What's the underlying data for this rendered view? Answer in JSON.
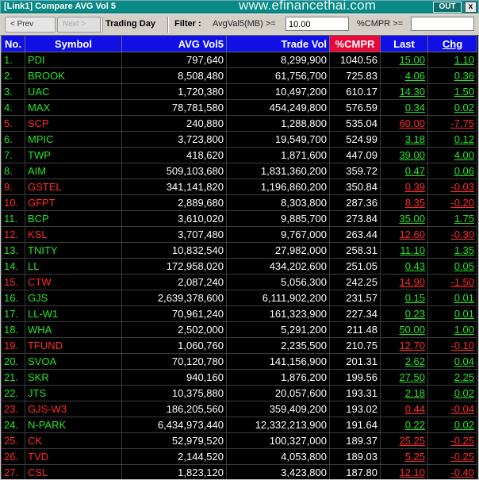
{
  "window": {
    "title": "[Link1] Compare AVG Vol 5",
    "watermark": "www.efinancethai.com",
    "out_label": "OUT",
    "close_label": "x"
  },
  "toolbar": {
    "prev_label": "< Prev",
    "next_label": "Next >",
    "trading_day_label": "Trading Day",
    "filter_label": "Filter :",
    "avgvol_caption": "AvgVal5(MB) >=",
    "avgvol_value": "10.00",
    "cmpr_caption": "%CMPR >=",
    "cmpr_value": ""
  },
  "colors": {
    "up": "#26e626",
    "down": "#ff2a2a",
    "header": "#1010e6",
    "sorted_header": "#e8083a"
  },
  "table": {
    "headers": {
      "no": "No.",
      "symbol": "Symbol",
      "avg_vol5": "AVG Vol5",
      "trade_vol": "Trade Vol",
      "cmpr": "%CMPR",
      "last": "Last",
      "chg": "Chg"
    },
    "rows": [
      {
        "no": "1.",
        "symbol": "PDI",
        "avg": "797,640",
        "vol": "8,299,900",
        "cmpr": "1040.56",
        "last": "15.00",
        "chg": "1.10",
        "dir": "up"
      },
      {
        "no": "2.",
        "symbol": "BROOK",
        "avg": "8,508,480",
        "vol": "61,756,700",
        "cmpr": "725.83",
        "last": "4.06",
        "chg": "0.36",
        "dir": "up"
      },
      {
        "no": "3.",
        "symbol": "UAC",
        "avg": "1,720,380",
        "vol": "10,497,200",
        "cmpr": "610.17",
        "last": "14.30",
        "chg": "1.50",
        "dir": "up"
      },
      {
        "no": "4.",
        "symbol": "MAX",
        "avg": "78,781,580",
        "vol": "454,249,800",
        "cmpr": "576.59",
        "last": "0.34",
        "chg": "0.02",
        "dir": "up"
      },
      {
        "no": "5.",
        "symbol": "SCP",
        "avg": "240,880",
        "vol": "1,288,800",
        "cmpr": "535.04",
        "last": "60.00",
        "chg": "-7.75",
        "dir": "down"
      },
      {
        "no": "6.",
        "symbol": "MPIC",
        "avg": "3,723,800",
        "vol": "19,549,700",
        "cmpr": "524.99",
        "last": "3.18",
        "chg": "0.12",
        "dir": "up"
      },
      {
        "no": "7.",
        "symbol": "TWP",
        "avg": "418,620",
        "vol": "1,871,600",
        "cmpr": "447.09",
        "last": "39.00",
        "chg": "4.00",
        "dir": "up"
      },
      {
        "no": "8.",
        "symbol": "AIM",
        "avg": "509,103,680",
        "vol": "1,831,360,200",
        "cmpr": "359.72",
        "last": "0.47",
        "chg": "0.06",
        "dir": "up"
      },
      {
        "no": "9.",
        "symbol": "GSTEL",
        "avg": "341,141,820",
        "vol": "1,196,860,200",
        "cmpr": "350.84",
        "last": "0.39",
        "chg": "-0.03",
        "dir": "down"
      },
      {
        "no": "10.",
        "symbol": "GFPT",
        "avg": "2,889,680",
        "vol": "8,303,800",
        "cmpr": "287.36",
        "last": "8.35",
        "chg": "-0.20",
        "dir": "down"
      },
      {
        "no": "11.",
        "symbol": "BCP",
        "avg": "3,610,020",
        "vol": "9,885,700",
        "cmpr": "273.84",
        "last": "35.00",
        "chg": "1.75",
        "dir": "up"
      },
      {
        "no": "12.",
        "symbol": "KSL",
        "avg": "3,707,480",
        "vol": "9,767,000",
        "cmpr": "263.44",
        "last": "12.60",
        "chg": "-0.30",
        "dir": "down"
      },
      {
        "no": "13.",
        "symbol": "TNITY",
        "avg": "10,832,540",
        "vol": "27,982,000",
        "cmpr": "258.31",
        "last": "11.10",
        "chg": "1.35",
        "dir": "up"
      },
      {
        "no": "14.",
        "symbol": "LL",
        "avg": "172,958,020",
        "vol": "434,202,600",
        "cmpr": "251.05",
        "last": "0.43",
        "chg": "0.05",
        "dir": "up"
      },
      {
        "no": "15.",
        "symbol": "CTW",
        "avg": "2,087,240",
        "vol": "5,056,300",
        "cmpr": "242.25",
        "last": "14.90",
        "chg": "-1.50",
        "dir": "down"
      },
      {
        "no": "16.",
        "symbol": "GJS",
        "avg": "2,639,378,600",
        "vol": "6,111,902,200",
        "cmpr": "231.57",
        "last": "0.15",
        "chg": "0.01",
        "dir": "up"
      },
      {
        "no": "17.",
        "symbol": "LL-W1",
        "avg": "70,961,240",
        "vol": "161,323,900",
        "cmpr": "227.34",
        "last": "0.23",
        "chg": "0.01",
        "dir": "up"
      },
      {
        "no": "18.",
        "symbol": "WHA",
        "avg": "2,502,000",
        "vol": "5,291,200",
        "cmpr": "211.48",
        "last": "50.00",
        "chg": "1.00",
        "dir": "up"
      },
      {
        "no": "19.",
        "symbol": "TFUND",
        "avg": "1,060,760",
        "vol": "2,235,500",
        "cmpr": "210.75",
        "last": "12.70",
        "chg": "-0.10",
        "dir": "down"
      },
      {
        "no": "20.",
        "symbol": "SVOA",
        "avg": "70,120,780",
        "vol": "141,156,900",
        "cmpr": "201.31",
        "last": "2.62",
        "chg": "0.04",
        "dir": "up"
      },
      {
        "no": "21.",
        "symbol": "SKR",
        "avg": "940,160",
        "vol": "1,876,200",
        "cmpr": "199.56",
        "last": "27.50",
        "chg": "2.25",
        "dir": "up"
      },
      {
        "no": "22.",
        "symbol": "JTS",
        "avg": "10,375,880",
        "vol": "20,057,600",
        "cmpr": "193.31",
        "last": "2.18",
        "chg": "0.02",
        "dir": "up"
      },
      {
        "no": "23.",
        "symbol": "GJS-W3",
        "avg": "186,205,560",
        "vol": "359,409,200",
        "cmpr": "193.02",
        "last": "0.44",
        "chg": "-0.04",
        "dir": "down"
      },
      {
        "no": "24.",
        "symbol": "N-PARK",
        "avg": "6,434,973,440",
        "vol": "12,332,213,900",
        "cmpr": "191.64",
        "last": "0.22",
        "chg": "0.02",
        "dir": "up"
      },
      {
        "no": "25.",
        "symbol": "CK",
        "avg": "52,979,520",
        "vol": "100,327,000",
        "cmpr": "189.37",
        "last": "25.25",
        "chg": "-0.25",
        "dir": "down"
      },
      {
        "no": "26.",
        "symbol": "TVD",
        "avg": "2,144,520",
        "vol": "4,053,800",
        "cmpr": "189.03",
        "last": "5.25",
        "chg": "-0.25",
        "dir": "down"
      },
      {
        "no": "27.",
        "symbol": "CSL",
        "avg": "1,823,120",
        "vol": "3,423,800",
        "cmpr": "187.80",
        "last": "12.10",
        "chg": "-0.40",
        "dir": "down"
      }
    ]
  }
}
